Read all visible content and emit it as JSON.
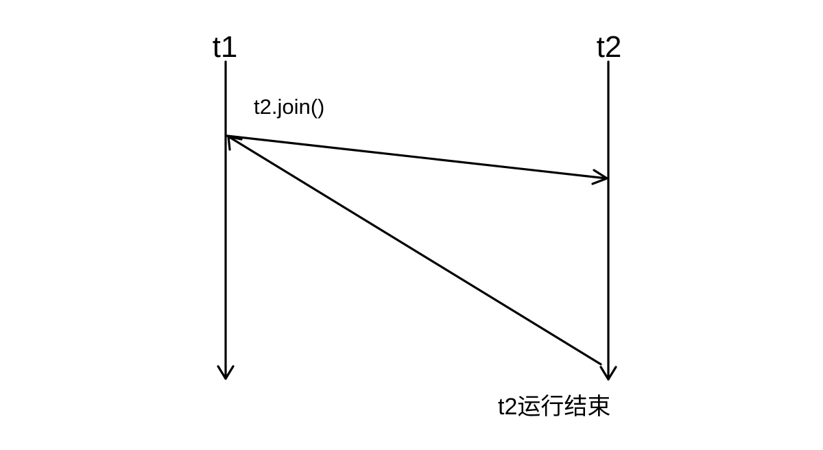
{
  "threads": {
    "t1": {
      "label": "t1"
    },
    "t2": {
      "label": "t2"
    }
  },
  "messages": {
    "join": {
      "label": "t2.join()"
    }
  },
  "events": {
    "t2_end": {
      "label": "t2运行结束"
    }
  },
  "colors": {
    "stroke": "#000000",
    "background": "#ffffff"
  }
}
